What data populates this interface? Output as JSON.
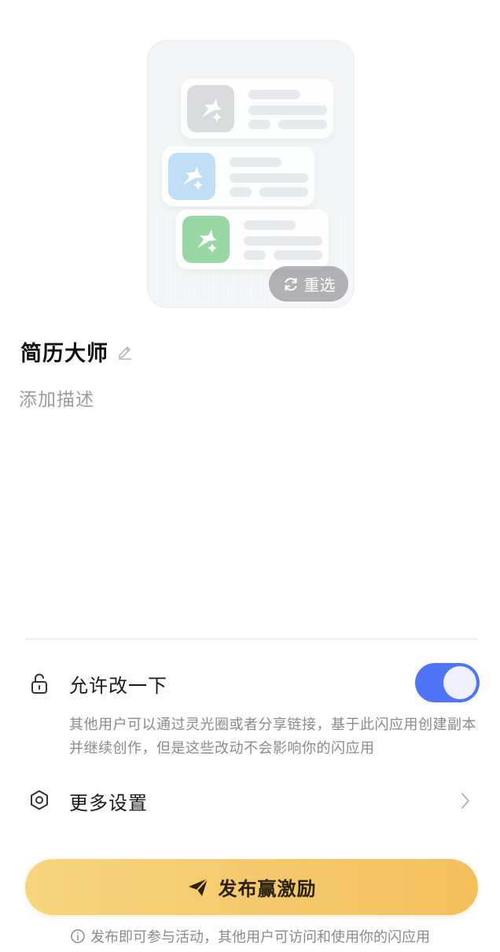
{
  "cover": {
    "reselect_label": "重选",
    "cards": [
      {
        "icon": "sparkle-plane-icon",
        "icon_color": "#d7d8da"
      },
      {
        "icon": "sparkle-plane-icon",
        "icon_color": "#bcdcf7"
      },
      {
        "icon": "sparkle-plane-icon",
        "icon_color": "#8fd39c"
      }
    ]
  },
  "app": {
    "name": "简历大师",
    "description_placeholder": "添加描述"
  },
  "settings": {
    "allow_edit": {
      "label": "允许改一下",
      "enabled": true,
      "explanation": "其他用户可以通过灵光圈或者分享链接，基于此闪应用创建副本并继续创作，但是这些改动不会影响你的闪应用"
    },
    "more": {
      "label": "更多设置"
    }
  },
  "publish": {
    "button_label": "发布赢激励",
    "note": "发布即可参与活动，其他用户可访问和使用你的闪应用"
  },
  "colors": {
    "toggle_on": "#4f74f7",
    "publish_start": "#f7d47e",
    "publish_end": "#f3c05c"
  }
}
